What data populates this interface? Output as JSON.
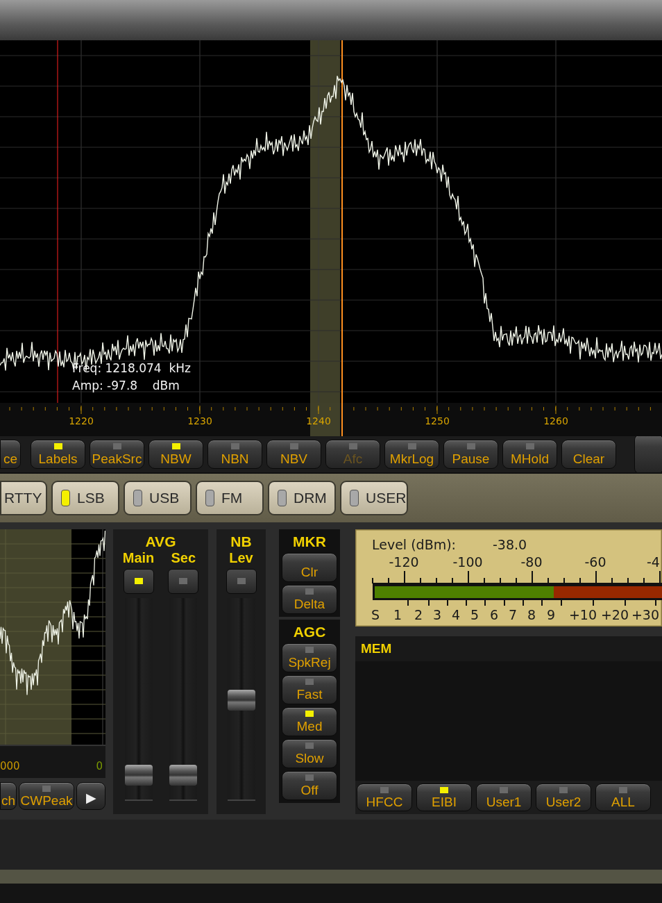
{
  "spectrum": {
    "readout": [
      "Freq: 1218.074  kHz",
      "Amp: -97.8    dBm"
    ],
    "axis_labels": [
      "1220",
      "1230",
      "1240",
      "1250",
      "1260"
    ]
  },
  "toolbar": [
    {
      "label": "ce",
      "kind": "plain",
      "disabled": false
    },
    {
      "label": "Labels",
      "kind": "led",
      "on": true,
      "disabled": false
    },
    {
      "label": "PeakSrc",
      "kind": "led",
      "on": false,
      "disabled": false
    },
    {
      "label": "NBW",
      "kind": "led",
      "on": true,
      "disabled": false
    },
    {
      "label": "NBN",
      "kind": "led",
      "on": false,
      "disabled": false
    },
    {
      "label": "NBV",
      "kind": "led",
      "on": false,
      "disabled": false
    },
    {
      "label": "Afc",
      "kind": "led",
      "on": false,
      "disabled": true
    },
    {
      "label": "MkrLog",
      "kind": "led",
      "on": false,
      "disabled": false
    },
    {
      "label": "Pause",
      "kind": "led",
      "on": false,
      "disabled": false
    },
    {
      "label": "MHold",
      "kind": "led",
      "on": false,
      "disabled": false
    },
    {
      "label": "Clear",
      "kind": "plain",
      "disabled": false
    }
  ],
  "modes": [
    {
      "label": "RTTY",
      "selected": false
    },
    {
      "label": "LSB",
      "selected": true
    },
    {
      "label": "USB",
      "selected": false
    },
    {
      "label": "FM",
      "selected": false
    },
    {
      "label": "DRM",
      "selected": false
    },
    {
      "label": "USER",
      "selected": false
    }
  ],
  "mini_spectrum": {
    "axis_labels": [
      "000",
      "0"
    ],
    "buttons": [
      {
        "label": "ch",
        "kind": "plain"
      },
      {
        "label": "CWPeak",
        "kind": "led",
        "on": false
      },
      {
        "label": "▶",
        "kind": "plain"
      }
    ]
  },
  "avg": {
    "title": "AVG",
    "channels": [
      {
        "label": "Main",
        "on": true,
        "level": 0.08
      },
      {
        "label": "Sec",
        "on": false,
        "level": 0.08
      }
    ]
  },
  "nb": {
    "title": "NB",
    "channels": [
      {
        "label": "Lev",
        "on": false,
        "level": 0.5
      }
    ]
  },
  "mkr": {
    "title": "MKR",
    "buttons": [
      {
        "label": "Clr",
        "kind": "plain"
      },
      {
        "label": "Delta",
        "kind": "led",
        "on": false
      }
    ]
  },
  "agc": {
    "title": "AGC",
    "buttons": [
      {
        "label": "SpkRej",
        "kind": "led",
        "on": false
      },
      {
        "label": "Fast",
        "kind": "led",
        "on": false
      },
      {
        "label": "Med",
        "kind": "led",
        "on": true
      },
      {
        "label": "Slow",
        "kind": "led",
        "on": false
      },
      {
        "label": "Off",
        "kind": "led",
        "on": false
      }
    ]
  },
  "meter": {
    "caption": "Level (dBm):",
    "reading": "-38.0",
    "dbm_labels": [
      "-120",
      "-100",
      "-80",
      "-60",
      "-4"
    ],
    "s_labels": [
      "S",
      "1",
      "2",
      "3",
      "4",
      "5",
      "6",
      "7",
      "8",
      "9",
      "+10",
      "+20",
      "+30"
    ]
  },
  "mem": {
    "title": "MEM",
    "buttons": [
      {
        "label": "HFCC",
        "on": false
      },
      {
        "label": "EIBI",
        "on": true
      },
      {
        "label": "User1",
        "on": false
      },
      {
        "label": "User2",
        "on": false
      },
      {
        "label": "ALL",
        "on": false
      }
    ]
  }
}
